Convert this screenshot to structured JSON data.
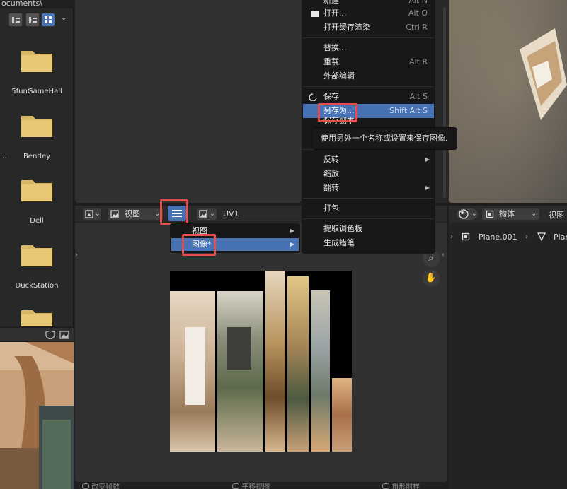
{
  "file_browser": {
    "path": "ocuments\\",
    "folders": [
      "5funGameHall",
      "Bentley",
      "Dell",
      "DuckStation"
    ],
    "side_label": "..."
  },
  "image_editor": {
    "header": {
      "view_mode_label": "视图",
      "image_name": "UV1"
    },
    "submenu": {
      "items": [
        {
          "label": "视图",
          "has_arrow": true
        },
        {
          "label": "图像*",
          "has_arrow": true
        }
      ]
    }
  },
  "image_menu": {
    "items": [
      {
        "label": "新建",
        "shortcut": "Alt N"
      },
      {
        "label": "打开...",
        "shortcut": "Alt O"
      },
      {
        "label": "打开缓存渲染",
        "shortcut": "Ctrl R"
      },
      {
        "label": "替换...",
        "shortcut": ""
      },
      {
        "label": "重载",
        "shortcut": "Alt R"
      },
      {
        "label": "外部编辑",
        "shortcut": ""
      },
      {
        "label": "保存",
        "shortcut": "Alt S"
      },
      {
        "label": "另存为...",
        "shortcut": "Shift Alt S"
      },
      {
        "label": "保存副本",
        "shortcut": ""
      },
      {
        "label": "反转",
        "shortcut": ""
      },
      {
        "label": "缩放",
        "shortcut": ""
      },
      {
        "label": "翻转",
        "shortcut": ""
      },
      {
        "label": "打包",
        "shortcut": ""
      },
      {
        "label": "提取调色板",
        "shortcut": ""
      },
      {
        "label": "生成蜡笔",
        "shortcut": ""
      }
    ],
    "tooltip": "使用另外一个名称或设置来保存图像."
  },
  "right_panel": {
    "mode_label": "物体",
    "view_label": "视图",
    "breadcrumb": {
      "object": "Plane.001",
      "mesh": "Plan"
    }
  },
  "status_bar": {
    "items": [
      "改变帧数",
      "平移视图",
      "角形附样"
    ]
  },
  "colors": {
    "accent": "#4772b3",
    "highlight_box": "#e84c4c",
    "menu_bg": "#181818",
    "panel_bg": "#303030"
  }
}
